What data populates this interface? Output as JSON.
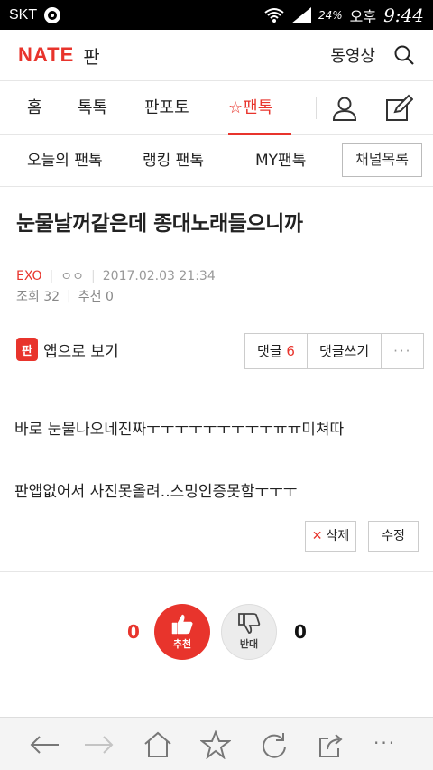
{
  "status": {
    "carrier": "SKT",
    "battery": "24%",
    "ampm": "오후",
    "time": "9:44"
  },
  "header": {
    "logo": "NATE",
    "section": "판",
    "video_link": "동영상"
  },
  "main_nav": {
    "tabs": [
      "홈",
      "톡톡",
      "판포토",
      "팬톡"
    ],
    "active_index": 3
  },
  "sub_nav": {
    "items": [
      "오늘의 팬톡",
      "랭킹 팬톡",
      "MY팬톡"
    ],
    "channel_button": "채널목록"
  },
  "post": {
    "title": "눈물날꺼같은데 종대노래들으니까",
    "channel": "EXO",
    "author": "ㅇㅇ",
    "date": "2017.02.03 21:34",
    "views": "조회 32",
    "recommend_label": "추천 0",
    "body": [
      "바로 눈물나오네진짜ㅜㅜㅜㅜㅜㅜㅜㅜㅜㅠㅠ미쳐따",
      "판앱없어서 사진못올려..스밍인증못함ㅜㅜㅜ"
    ]
  },
  "app_view": {
    "badge": "판",
    "label": "앱으로 보기"
  },
  "comments": {
    "label": "댓글",
    "count": "6",
    "write_label": "댓글쓰기",
    "more": "···"
  },
  "actions": {
    "delete": "삭제",
    "edit": "수정"
  },
  "votes": {
    "up_count": "0",
    "up_label": "추천",
    "down_count": "0",
    "down_label": "반대"
  },
  "browser": {
    "more": "···"
  },
  "colors": {
    "accent": "#e8342c"
  }
}
